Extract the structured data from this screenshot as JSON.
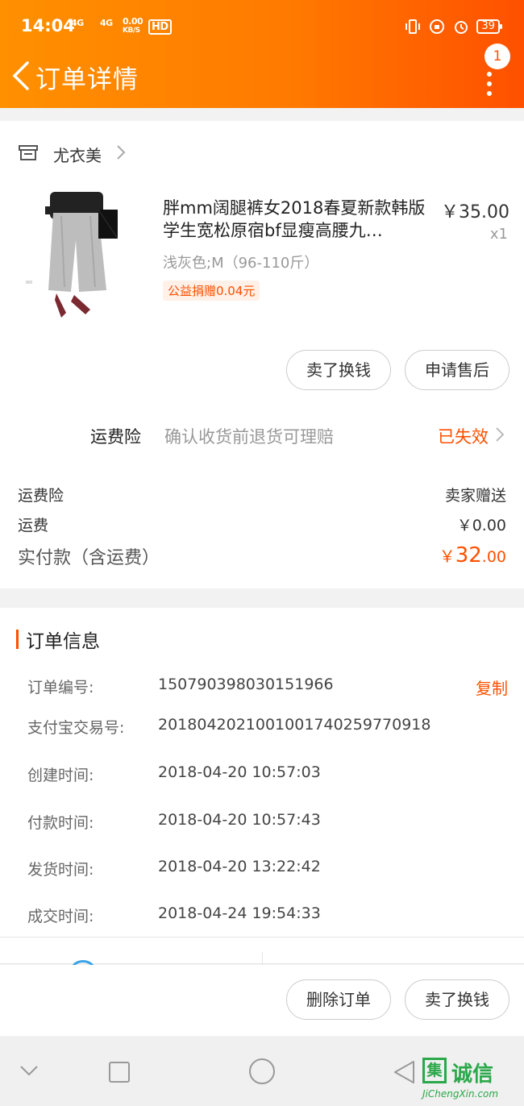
{
  "status_bar": {
    "time": "14:04",
    "signal_1": "4G",
    "signal_2": "4G",
    "net_speed_top": "0.00",
    "net_speed_unit": "KB/S",
    "hd_label": "HD",
    "battery": "39"
  },
  "header": {
    "title": "订单详情",
    "notification_count": "1",
    "accent_color": "#ff5000"
  },
  "shop": {
    "name": "尤衣美"
  },
  "product": {
    "title": "胖mm阔腿裤女2018春夏新款韩版学生宽松原宿bf显瘦高腰九…",
    "price": "￥35.00",
    "quantity": "x1",
    "sku": "浅灰色;M（96-110斤）",
    "charity_tag": "公益捐赠0.04元"
  },
  "item_actions": {
    "sell_label": "卖了换钱",
    "after_sale_label": "申请售后"
  },
  "shipping_insurance": {
    "label": "运费险",
    "description": "确认收货前退货可理赔",
    "status": "已失效"
  },
  "fees": {
    "insurance_label": "运费险",
    "insurance_value": "卖家赠送",
    "shipping_label": "运费",
    "shipping_value": "￥0.00",
    "total_label": "实付款（含运费）",
    "total_symbol": "￥",
    "total_int": "32",
    "total_dec": ".00"
  },
  "order_info": {
    "heading": "订单信息",
    "copy_label": "复制",
    "rows": [
      {
        "key": "订单编号:",
        "value": "150790398030151966"
      },
      {
        "key": "支付宝交易号:",
        "value": "2018042021001001740259770918"
      },
      {
        "key": "创建时间:",
        "value": "2018-04-20 10:57:03"
      },
      {
        "key": "付款时间:",
        "value": "2018-04-20 10:57:43"
      },
      {
        "key": "发货时间:",
        "value": "2018-04-20 13:22:42"
      },
      {
        "key": "成交时间:",
        "value": "2018-04-24 19:54:33"
      }
    ]
  },
  "bottom_actions": {
    "delete_label": "删除订单",
    "sell_label": "卖了换钱"
  },
  "watermark": {
    "box_char": "集",
    "brand": "诚信",
    "url": "JiChengXin.com"
  }
}
